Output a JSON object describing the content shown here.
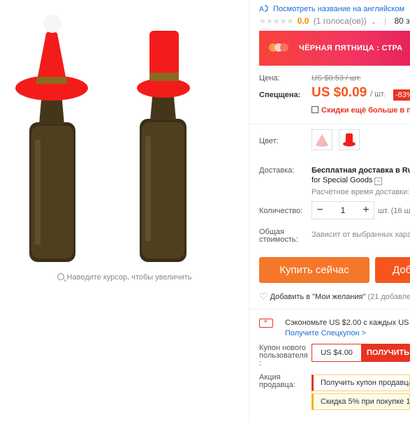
{
  "colors": {
    "accent_orange": "#f5561e",
    "buy_button": "#f5772a",
    "link_blue": "#1a6ad8",
    "red": "#e8331f",
    "banner_red": "#f8433c"
  },
  "gallery": {
    "zoom_hint": "Наведите курсор, чтобы увеличить",
    "zoom_icon": "magnifier-icon"
  },
  "header": {
    "translate_link": "Посмотреть название на английском"
  },
  "rating": {
    "stars": "★★★★★",
    "value": "0.0",
    "votes": "(1 голоса(ов))",
    "chevron": "⌄",
    "separator": "|",
    "orders": "80 зака"
  },
  "banner": {
    "text": "ЧЁРНАЯ ПЯТНИЦА : СТРА"
  },
  "price": {
    "label": "Цена:",
    "old": "US $0.53 / шт.",
    "special_label": "Спецщена:",
    "special": "US $0.09",
    "unit": "/ шт.",
    "discount": "-83%",
    "promo": "Скидки ещё больше в пр"
  },
  "color": {
    "label": "Цвет:"
  },
  "shipping": {
    "label": "Доставка:",
    "main": "Бесплатная доставка в Rus",
    "sub": "for Special Goods",
    "estimate": "Расчётное время доставки:"
  },
  "quantity": {
    "label": "Количество:",
    "minus": "−",
    "value": "1",
    "plus": "+",
    "unit": "шт. (16 ш"
  },
  "total": {
    "label": "Общая стоимость:",
    "value": "Зависит от выбранных хара"
  },
  "actions": {
    "buy": "Купить сейчас",
    "cart": "Доб"
  },
  "wishlist": {
    "text": "Добавить в \"Мои желания\"",
    "count": "(21 добавле"
  },
  "coupon": {
    "line": "Сэкономьте US $2.00 с каждых US $",
    "link": "Получите Спецкупон >"
  },
  "new_user": {
    "label": "Купон нового пользователя :",
    "amount": "US $4.00",
    "get": "ПОЛУЧИТЬ"
  },
  "seller_promo": {
    "label": "Акция продавца:",
    "item1": "Получить купон продавца",
    "item2": "Скидка 5% при покупке 10"
  }
}
